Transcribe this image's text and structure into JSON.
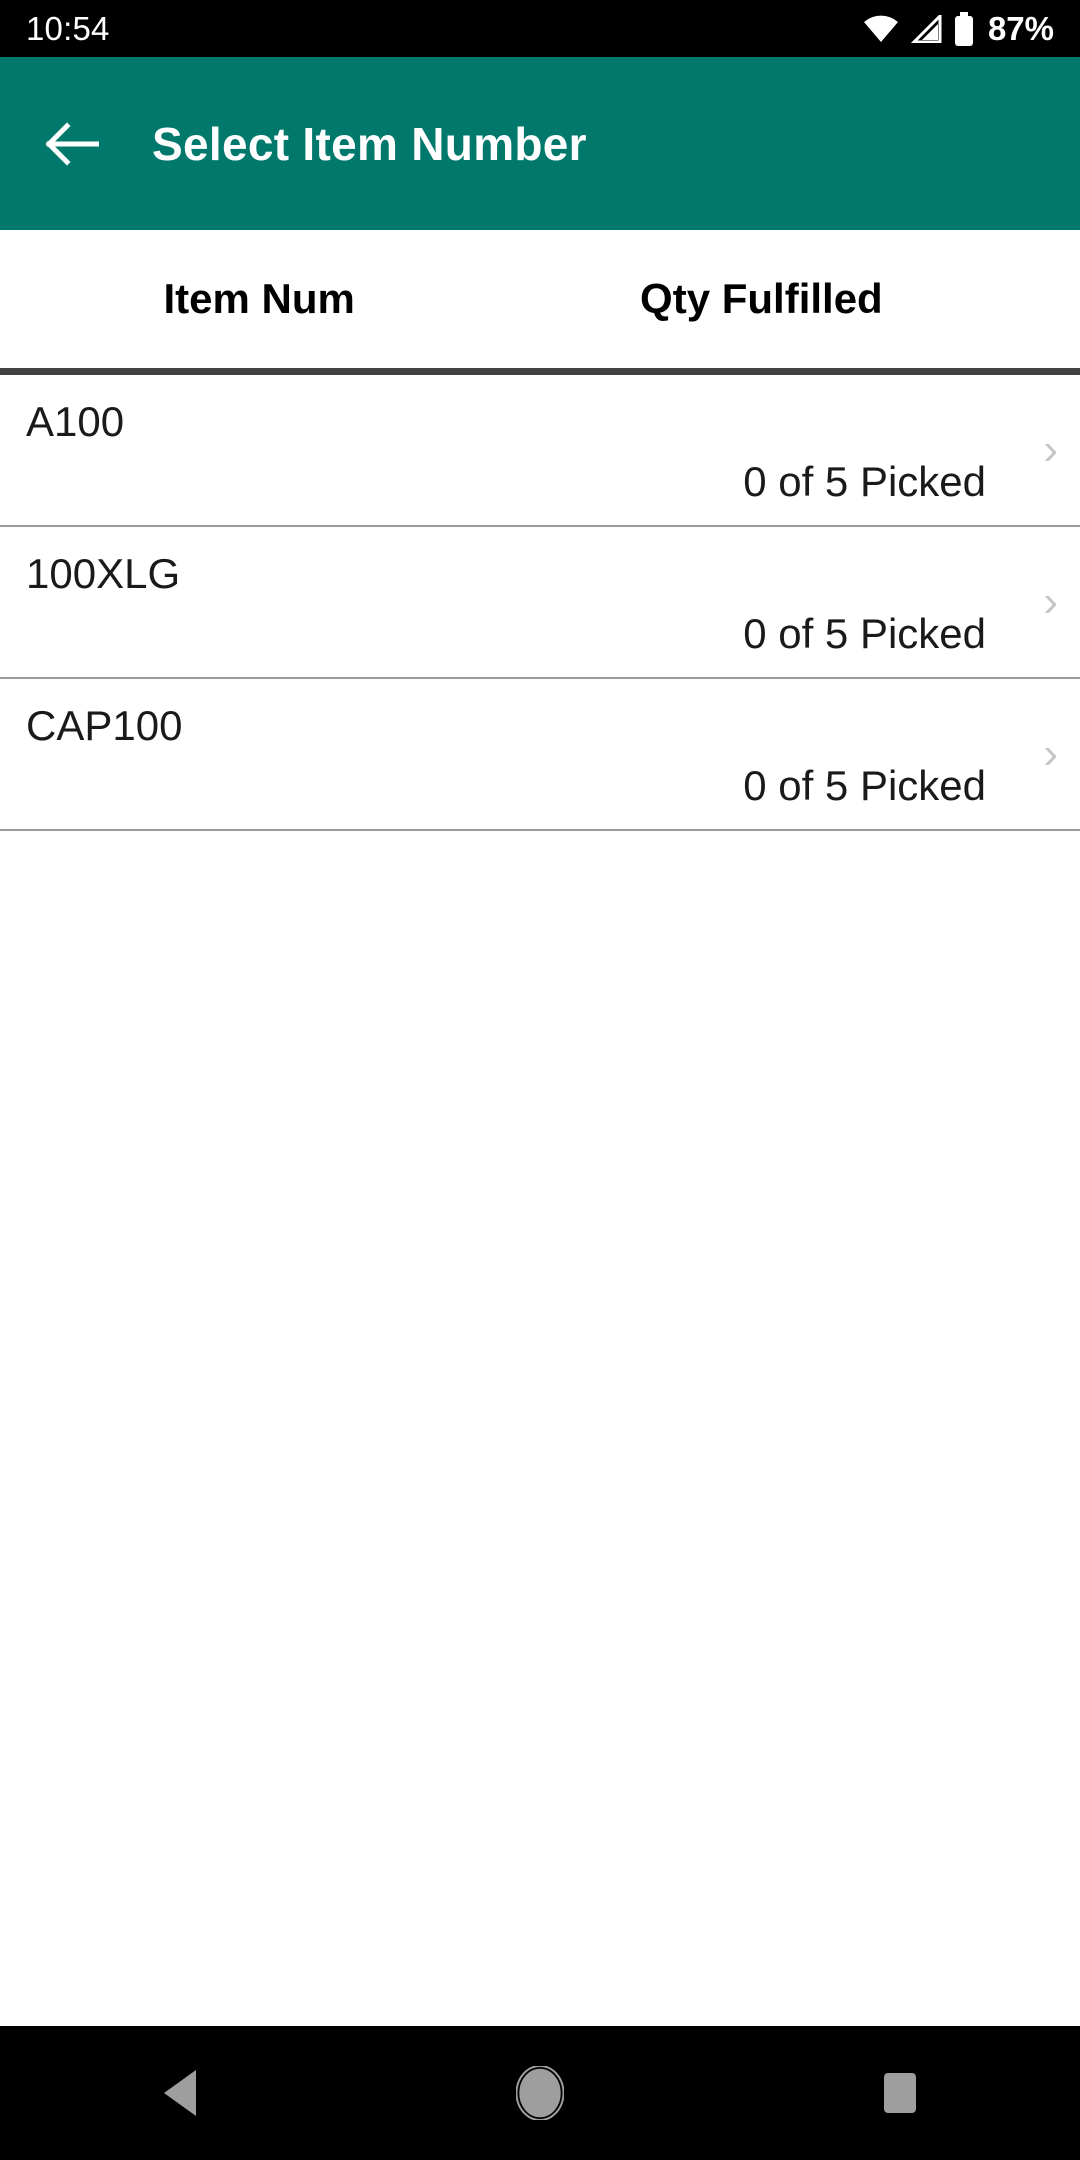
{
  "status_bar": {
    "clock": "10:54",
    "battery_percent": "87%",
    "icons": [
      "wifi-icon",
      "cellular-signal-icon",
      "battery-icon"
    ]
  },
  "app_bar": {
    "back_icon": "back-arrow-icon",
    "title": "Select Item Number",
    "background_color": "#00786b",
    "title_color": "#ffffff"
  },
  "table": {
    "columns": [
      "Item Num",
      "Qty Fulfilled"
    ],
    "rows": [
      {
        "item_num": "A100",
        "qty_fulfilled": "0 of 5 Picked",
        "chevron": "›"
      },
      {
        "item_num": "100XLG",
        "qty_fulfilled": "0 of 5 Picked",
        "chevron": "›"
      },
      {
        "item_num": "CAP100",
        "qty_fulfilled": "0 of 5 Picked",
        "chevron": "›"
      }
    ]
  },
  "nav_bar": {
    "back_label": "back-triangle-icon",
    "home_label": "home-circle-icon",
    "recents_label": "recents-square-icon",
    "icon_color": "#9e9e9e"
  }
}
